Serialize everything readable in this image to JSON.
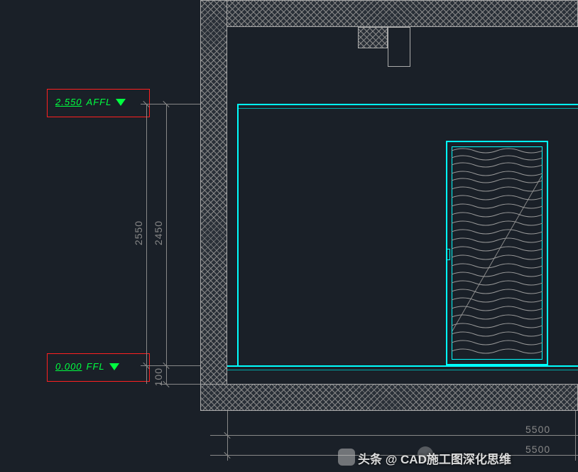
{
  "elevation_markers": {
    "top": {
      "value": "2.550",
      "label": "AFFL"
    },
    "bottom": {
      "value": "0.000",
      "label": "FFL"
    }
  },
  "dimensions": {
    "vertical": {
      "overall": "2550",
      "ceiling_to_floor": "2450",
      "floor_slab": "100"
    },
    "horizontal": {
      "inner": "5500",
      "overall": "5500"
    }
  },
  "watermark": {
    "toutiao": "头条 @ CAD施工图深化思维"
  }
}
